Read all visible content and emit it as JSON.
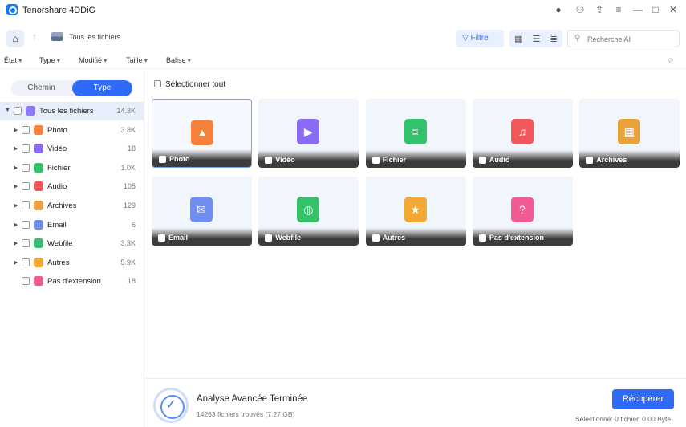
{
  "app": {
    "title": "Tenorshare 4DDiG"
  },
  "nav": {
    "breadcrumb": "Tous les fichiers",
    "filter_label": "Filtre",
    "search_placeholder": "Recherche AI"
  },
  "filters": [
    {
      "label": "État",
      "name": "filter-etat-dropdown"
    },
    {
      "label": "Type",
      "name": "filter-type-dropdown"
    },
    {
      "label": "Modifié",
      "name": "filter-modifie-dropdown"
    },
    {
      "label": "Taille",
      "name": "filter-taille-dropdown"
    },
    {
      "label": "Balise",
      "name": "filter-balise-dropdown"
    }
  ],
  "sidebar": {
    "tab_path": "Chemin",
    "tab_type": "Type",
    "root": {
      "label": "Tous les fichiers",
      "count": "14.3K",
      "color": "#8b7cf6"
    },
    "items": [
      {
        "key": "photo",
        "label": "Photo",
        "count": "3.8K",
        "color": "#f5813a",
        "caret": true
      },
      {
        "key": "video",
        "label": "Vidéo",
        "count": "18",
        "color": "#8a6cf3",
        "caret": true
      },
      {
        "key": "fichier",
        "label": "Fichier",
        "count": "1.0K",
        "color": "#33c16c",
        "caret": true
      },
      {
        "key": "audio",
        "label": "Audio",
        "count": "105",
        "color": "#f2585b",
        "caret": true
      },
      {
        "key": "archives",
        "label": "Archives",
        "count": "129",
        "color": "#e8a33a",
        "caret": true
      },
      {
        "key": "email",
        "label": "Email",
        "count": "6",
        "color": "#6f8ef0",
        "caret": true
      },
      {
        "key": "webfile",
        "label": "Webfile",
        "count": "3.3K",
        "color": "#37c06a",
        "caret": true
      },
      {
        "key": "autres",
        "label": "Autres",
        "count": "5.9K",
        "color": "#f3a834",
        "caret": true
      },
      {
        "key": "pas-extension",
        "label": "Pas d'extension",
        "count": "18",
        "color": "#f05b93",
        "caret": false
      }
    ]
  },
  "main": {
    "select_all_label": "Sélectionner tout",
    "cards": [
      {
        "key": "photo",
        "label": "Photo",
        "color": "#f5813a",
        "glyph": "▲",
        "active": true
      },
      {
        "key": "video",
        "label": "Vidéo",
        "color": "#8a6cf3",
        "glyph": "▶"
      },
      {
        "key": "fichier",
        "label": "Fichier",
        "color": "#33c16c",
        "glyph": "≡"
      },
      {
        "key": "audio",
        "label": "Audio",
        "color": "#f2585b",
        "glyph": "♫"
      },
      {
        "key": "archives",
        "label": "Archives",
        "color": "#e8a33a",
        "glyph": "▦"
      },
      {
        "key": "email",
        "label": "Email",
        "color": "#6f8ef0",
        "glyph": "✉"
      },
      {
        "key": "webfile",
        "label": "Webfile",
        "color": "#37c06a",
        "glyph": "◍"
      },
      {
        "key": "autres",
        "label": "Autres",
        "color": "#f3a834",
        "glyph": "★"
      },
      {
        "key": "pas-extension",
        "label": "Pas d'extension",
        "color": "#f05b93",
        "glyph": "?"
      }
    ]
  },
  "status": {
    "title": "Analyse Avancée Terminée",
    "subtitle": "14263 fichiers trouvés (7.27 GB)",
    "recover_label": "Récupérer",
    "selection_info": "Sélectionné: 0 fichier, 0.00 Byte"
  },
  "colors": {
    "accent": "#2f6bf6",
    "selected_row": "#e7edfb"
  }
}
